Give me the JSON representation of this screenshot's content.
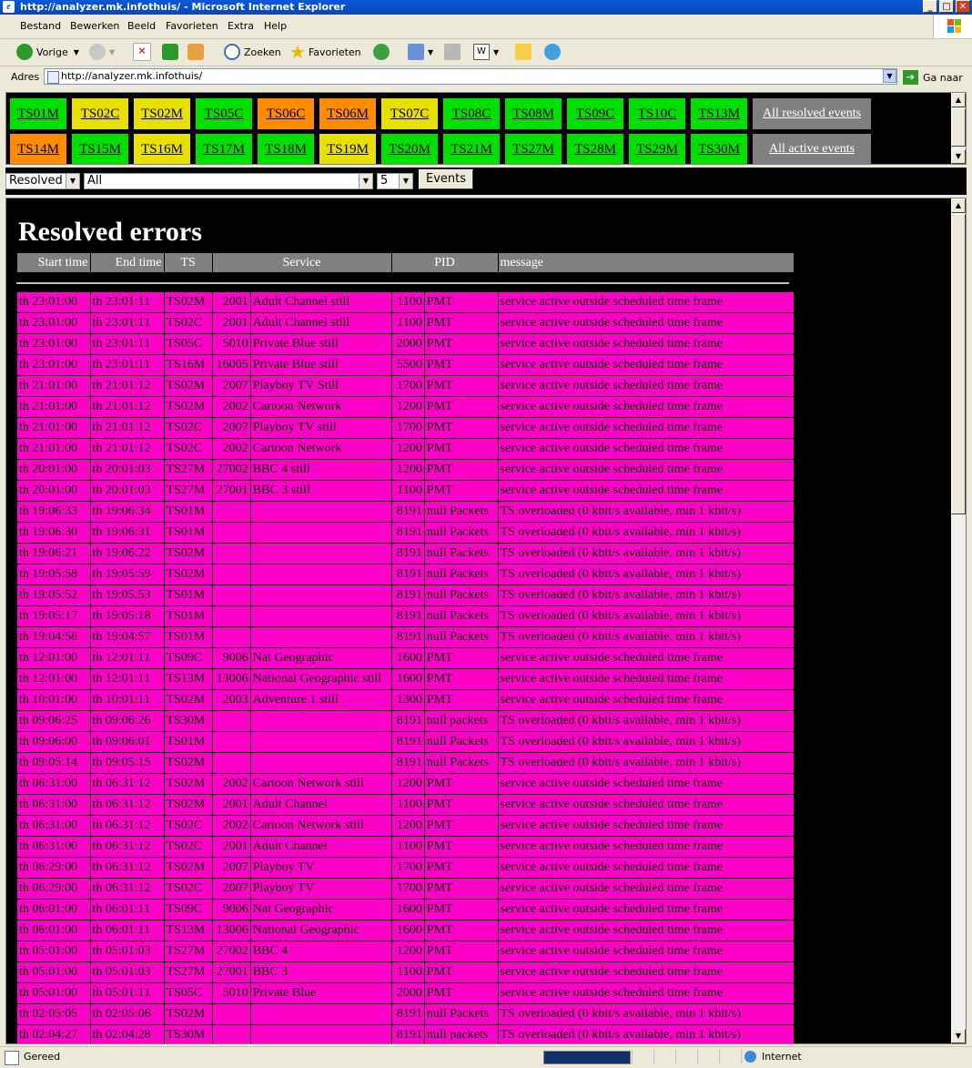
{
  "window": {
    "title": "http://analyzer.mk.infothuis/ - Microsoft Internet Explorer"
  },
  "menu": [
    "Bestand",
    "Bewerken",
    "Beeld",
    "Favorieten",
    "Extra",
    "Help"
  ],
  "toolbar": {
    "back": "Vorige",
    "search": "Zoeken",
    "favorites": "Favorieten"
  },
  "address": {
    "label": "Adres",
    "url": "http://analyzer.mk.infothuis/",
    "go": "Ga naar"
  },
  "ts_rows": [
    [
      {
        "label": "TS01M",
        "color": "#00e000"
      },
      {
        "label": "TS02C",
        "color": "#e8e000"
      },
      {
        "label": "TS02M",
        "color": "#e8e000"
      },
      {
        "label": "TS05C",
        "color": "#00e000"
      },
      {
        "label": "TS06C",
        "color": "#ff8c00"
      },
      {
        "label": "TS06M",
        "color": "#ff8c00"
      },
      {
        "label": "TS07C",
        "color": "#e8e000"
      },
      {
        "label": "TS08C",
        "color": "#00e000"
      },
      {
        "label": "TS08M",
        "color": "#00e000"
      },
      {
        "label": "TS09C",
        "color": "#00e000"
      },
      {
        "label": "TS10C",
        "color": "#00e000"
      },
      {
        "label": "TS13M",
        "color": "#00e000"
      },
      {
        "label": "All resolved events",
        "color": "#808080"
      }
    ],
    [
      {
        "label": "TS14M",
        "color": "#ff8c00"
      },
      {
        "label": "TS15M",
        "color": "#00e000"
      },
      {
        "label": "TS16M",
        "color": "#e8e000"
      },
      {
        "label": "TS17M",
        "color": "#00e000"
      },
      {
        "label": "TS18M",
        "color": "#00e000"
      },
      {
        "label": "TS19M",
        "color": "#e8e000"
      },
      {
        "label": "TS20M",
        "color": "#00e000"
      },
      {
        "label": "TS21M",
        "color": "#00e000"
      },
      {
        "label": "TS27M",
        "color": "#00e000"
      },
      {
        "label": "TS28M",
        "color": "#00e000"
      },
      {
        "label": "TS29M",
        "color": "#00e000"
      },
      {
        "label": "TS30M",
        "color": "#00e000"
      },
      {
        "label": "All active events",
        "color": "#808080"
      }
    ]
  ],
  "controls": {
    "filter": "Resolved",
    "ts": "All",
    "count": "5",
    "button": "Events"
  },
  "page_title": "Resolved errors",
  "table": {
    "headers": [
      "Start time",
      "End time",
      "TS",
      "Service",
      "PID",
      "message"
    ],
    "rows": [
      [
        "th 23:01:00",
        "th 23:01:11",
        "TS02M",
        "2001",
        "Adult Channel still",
        "1100",
        "PMT",
        "service active outside scheduled time frame"
      ],
      [
        "th 23:01:00",
        "th 23:01:11",
        "TS02C",
        "2001",
        "Adult Channel still",
        "1100",
        "PMT",
        "service active outside scheduled time frame"
      ],
      [
        "th 23:01:00",
        "th 23:01:11",
        "TS05C",
        "5010",
        "Private Blue still",
        "2000",
        "PMT",
        "service active outside scheduled time frame"
      ],
      [
        "th 23:01:00",
        "th 23:01:11",
        "TS16M",
        "16005",
        "Private Blue still",
        "5500",
        "PMT",
        "service active outside scheduled time frame"
      ],
      [
        "th 21:01:00",
        "th 21:01:12",
        "TS02M",
        "2007",
        "Playboy TV Still",
        "1700",
        "PMT",
        "service active outside scheduled time frame"
      ],
      [
        "th 21:01:00",
        "th 21:01:12",
        "TS02M",
        "2002",
        "Cartoon Network",
        "1200",
        "PMT",
        "service active outside scheduled time frame"
      ],
      [
        "th 21:01:00",
        "th 21:01:12",
        "TS02C",
        "2007",
        "Playboy TV still",
        "1700",
        "PMT",
        "service active outside scheduled time frame"
      ],
      [
        "th 21:01:00",
        "th 21:01:12",
        "TS02C",
        "2002",
        "Cartoon Network",
        "1200",
        "PMT",
        "service active outside scheduled time frame"
      ],
      [
        "th 20:01:00",
        "th 20:01:03",
        "TS27M",
        "27002",
        "BBC 4 still",
        "1200",
        "PMT",
        "service active outside scheduled time frame"
      ],
      [
        "th 20:01:00",
        "th 20:01:03",
        "TS27M",
        "27001",
        "BBC 3 still",
        "1100",
        "PMT",
        "service active outside scheduled time frame"
      ],
      [
        "th 19:06:33",
        "th 19:06:34",
        "TS01M",
        "",
        "",
        "8191",
        "null Packets",
        "TS overloaded (0 kbit/s available, min 1 kbit/s)"
      ],
      [
        "th 19:06:30",
        "th 19:06:31",
        "TS01M",
        "",
        "",
        "8191",
        "null Packets",
        "TS overloaded (0 kbit/s available, min 1 kbit/s)"
      ],
      [
        "th 19:06:21",
        "th 19:06:22",
        "TS02M",
        "",
        "",
        "8191",
        "null Packets",
        "TS overloaded (0 kbit/s available, min 1 kbit/s)"
      ],
      [
        "th 19:05:58",
        "th 19:05:59",
        "TS02M",
        "",
        "",
        "8191",
        "null Packets",
        "TS overloaded (0 kbit/s available, min 1 kbit/s)"
      ],
      [
        "th 19:05:52",
        "th 19:05:53",
        "TS01M",
        "",
        "",
        "8191",
        "null Packets",
        "TS overloaded (0 kbit/s available, min 1 kbit/s)"
      ],
      [
        "th 19:05:17",
        "th 19:05:18",
        "TS01M",
        "",
        "",
        "8191",
        "null Packets",
        "TS overloaded (0 kbit/s available, min 1 kbit/s)"
      ],
      [
        "th 19:04:56",
        "th 19:04:57",
        "TS01M",
        "",
        "",
        "8191",
        "null Packets",
        "TS overloaded (0 kbit/s available, min 1 kbit/s)"
      ],
      [
        "th 12:01:00",
        "th 12:01:11",
        "TS09C",
        "9006",
        "Nat Geographic",
        "1600",
        "PMT",
        "service active outside scheduled time frame"
      ],
      [
        "th 12:01:00",
        "th 12:01:11",
        "TS13M",
        "13006",
        "National Geographic still",
        "1600",
        "PMT",
        "service active outside scheduled time frame"
      ],
      [
        "th 10:01:00",
        "th 10:01:11",
        "TS02M",
        "2003",
        "Adventure 1 still",
        "1300",
        "PMT",
        "service active outside scheduled time frame"
      ],
      [
        "th 09:06:25",
        "th 09:06:26",
        "TS30M",
        "",
        "",
        "8191",
        "null packets",
        "TS overloaded (0 kbit/s available, min 1 kbit/s)"
      ],
      [
        "th 09:06:00",
        "th 09:06:01",
        "TS01M",
        "",
        "",
        "8191",
        "null Packets",
        "TS overloaded (0 kbit/s available, min 1 kbit/s)"
      ],
      [
        "th 09:05:14",
        "th 09:05:15",
        "TS02M",
        "",
        "",
        "8191",
        "null Packets",
        "TS overloaded (0 kbit/s available, min 1 kbit/s)"
      ],
      [
        "th 06:31:00",
        "th 06:31:12",
        "TS02M",
        "2002",
        "Cartoon Network still",
        "1200",
        "PMT",
        "service active outside scheduled time frame"
      ],
      [
        "th 06:31:00",
        "th 06:31:12",
        "TS02M",
        "2001",
        "Adult Channel",
        "1100",
        "PMT",
        "service active outside scheduled time frame"
      ],
      [
        "th 06:31:00",
        "th 06:31:12",
        "TS02C",
        "2002",
        "Cartoon Network still",
        "1200",
        "PMT",
        "service active outside scheduled time frame"
      ],
      [
        "th 06:31:00",
        "th 06:31:12",
        "TS02C",
        "2001",
        "Adult Channel",
        "1100",
        "PMT",
        "service active outside scheduled time frame"
      ],
      [
        "th 06:29:00",
        "th 06:31:12",
        "TS02M",
        "2007",
        "Playboy TV",
        "1700",
        "PMT",
        "service active outside scheduled time frame"
      ],
      [
        "th 06:29:00",
        "th 06:31:12",
        "TS02C",
        "2007",
        "Playboy TV",
        "1700",
        "PMT",
        "service active outside scheduled time frame"
      ],
      [
        "th 06:01:00",
        "th 06:01:11",
        "TS09C",
        "9006",
        "Nat Geographic",
        "1600",
        "PMT",
        "service active outside scheduled time frame"
      ],
      [
        "th 06:01:00",
        "th 06:01:11",
        "TS13M",
        "13006",
        "National Geographic",
        "1600",
        "PMT",
        "service active outside scheduled time frame"
      ],
      [
        "th 05:01:00",
        "th 05:01:03",
        "TS27M",
        "27002",
        "BBC 4",
        "1200",
        "PMT",
        "service active outside scheduled time frame"
      ],
      [
        "th 05:01:00",
        "th 05:01:03",
        "TS27M",
        "27001",
        "BBC 3",
        "1100",
        "PMT",
        "service active outside scheduled time frame"
      ],
      [
        "th 05:01:00",
        "th 05:01:11",
        "TS05C",
        "5010",
        "Private Blue",
        "2000",
        "PMT",
        "service active outside scheduled time frame"
      ],
      [
        "th 02:05:05",
        "th 02:05:06",
        "TS02M",
        "",
        "",
        "8191",
        "null Packets",
        "TS overloaded (0 kbit/s available, min 1 kbit/s)"
      ],
      [
        "th 02:04:27",
        "th 02:04:28",
        "TS30M",
        "",
        "",
        "8191",
        "null packets",
        "TS overloaded (0 kbit/s available, min 1 kbit/s)"
      ]
    ]
  },
  "status": {
    "text": "Gereed",
    "zone": "Internet"
  },
  "colors": {
    "row": "#ff00c8",
    "header": "#808080",
    "ok": "#00e000",
    "warn": "#e8e000",
    "alert": "#ff8c00"
  }
}
